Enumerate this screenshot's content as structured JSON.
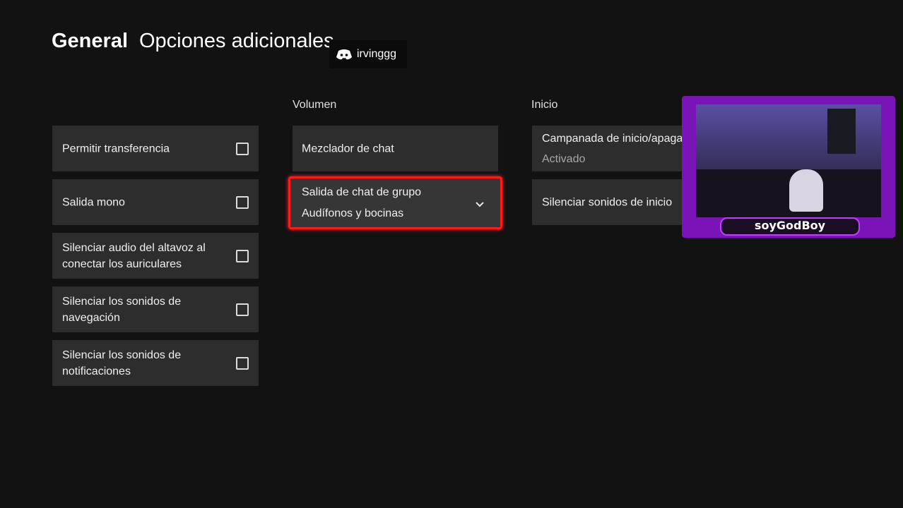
{
  "header": {
    "title": "General",
    "subtitle": "Opciones adicionales"
  },
  "discord_overlay": {
    "username": "irvinggg",
    "icon": "discord-icon"
  },
  "left_column": {
    "items": [
      {
        "label": "Permitir transferencia",
        "checked": false
      },
      {
        "label": "Salida mono",
        "checked": false
      },
      {
        "label": "Silenciar audio del altavoz al conectar los auriculares",
        "checked": false
      },
      {
        "label": "Silenciar los sonidos de navegación",
        "checked": false
      },
      {
        "label": "Silenciar los sonidos de notificaciones",
        "checked": false
      }
    ]
  },
  "volume_column": {
    "label": "Volumen",
    "chat_mixer": "Mezclador de chat",
    "group_chat_output": {
      "label": "Salida de chat de grupo",
      "value": "Audífonos y bocinas"
    }
  },
  "start_column": {
    "label": "Inicio",
    "chime": {
      "label": "Campanada de inicio/apaga",
      "value": "Activado"
    },
    "mute_start_sounds": "Silenciar sonidos de inicio"
  },
  "webcam_overlay": {
    "name": "soyGodBoy",
    "frame_color": "#7a13b8"
  },
  "colors": {
    "background": "#121212",
    "tile": "#2d2d2d",
    "focus": "#ff1a1a"
  }
}
